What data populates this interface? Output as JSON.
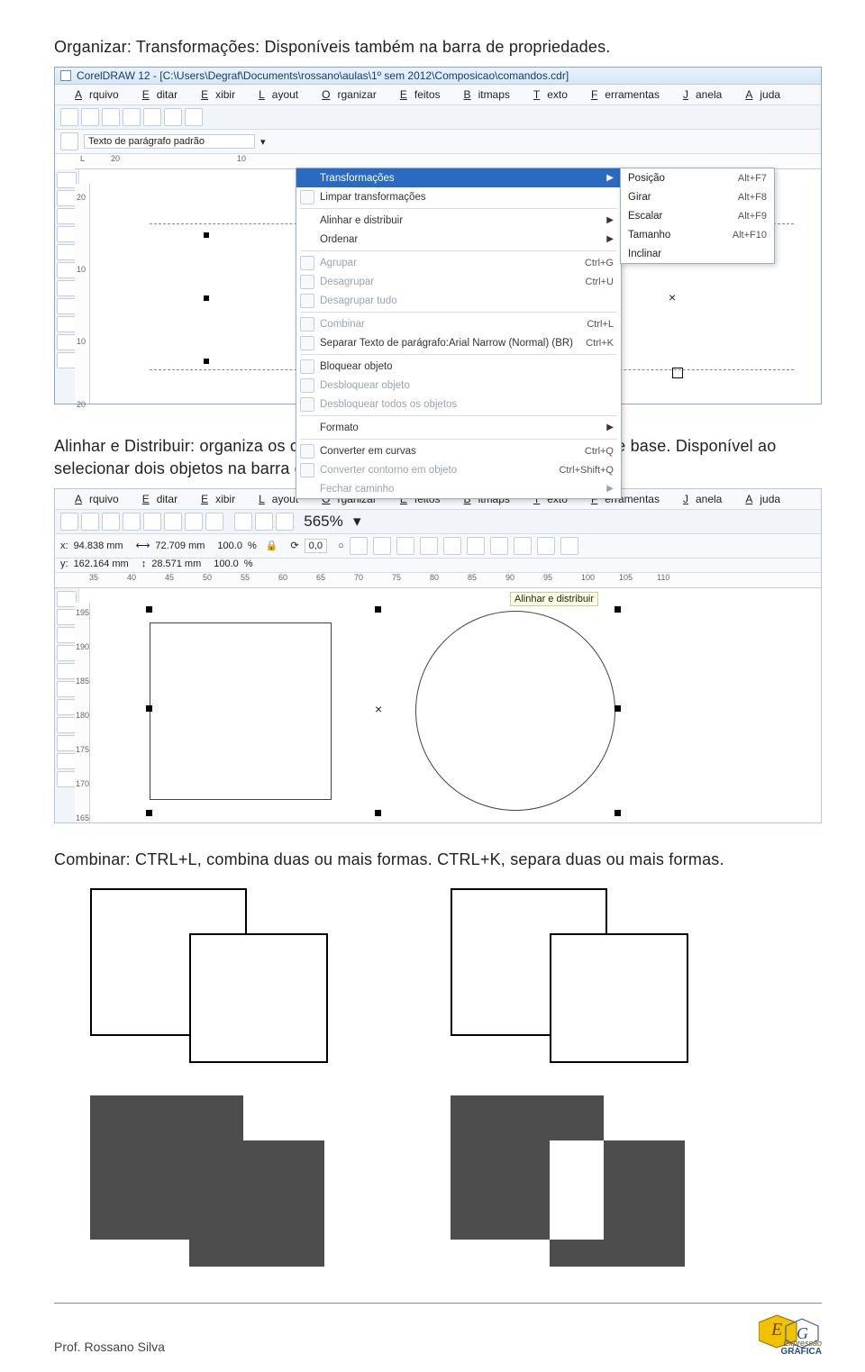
{
  "heading1": "Organizar: Transformações: Disponíveis também na barra de propriedades.",
  "screenshot1": {
    "title": "CorelDRAW 12 - [C:\\Users\\Degraf\\Documents\\rossano\\aulas\\1º sem 2012\\Composicao\\comandos.cdr]",
    "menubar": [
      "Arquivo",
      "Editar",
      "Exibir",
      "Layout",
      "Organizar",
      "Efeitos",
      "Bitmaps",
      "Texto",
      "Ferramentas",
      "Janela",
      "Ajuda"
    ],
    "prop_field": "Texto de parágrafo padrão ",
    "ruler_start": "L",
    "ruler_val": "20",
    "menu_items": [
      {
        "label": "Transformações",
        "sel": true,
        "arrow": true
      },
      {
        "label": "Limpar transformações",
        "icon": true
      },
      {
        "sep": true
      },
      {
        "label": "Alinhar e distribuir",
        "arrow": true
      },
      {
        "label": "Ordenar",
        "arrow": true
      },
      {
        "sep": true
      },
      {
        "label": "Agrupar",
        "dis": true,
        "icon": true,
        "sc": "Ctrl+G"
      },
      {
        "label": "Desagrupar",
        "dis": true,
        "icon": true,
        "sc": "Ctrl+U"
      },
      {
        "label": "Desagrupar tudo",
        "dis": true,
        "icon": true
      },
      {
        "sep": true
      },
      {
        "label": "Combinar",
        "dis": true,
        "icon": true,
        "sc": "Ctrl+L"
      },
      {
        "label": "Separar Texto de parágrafo:Arial Narrow (Normal) (BR)",
        "icon": true,
        "sc": "Ctrl+K"
      },
      {
        "sep": true
      },
      {
        "label": "Bloquear objeto",
        "icon": true
      },
      {
        "label": "Desbloquear objeto",
        "dis": true,
        "icon": true
      },
      {
        "label": "Desbloquear todos os objetos",
        "dis": true,
        "icon": true
      },
      {
        "sep": true
      },
      {
        "label": "Formato",
        "arrow": true
      },
      {
        "sep": true
      },
      {
        "label": "Converter em curvas",
        "icon": true,
        "sc": "Ctrl+Q"
      },
      {
        "label": "Converter contorno em objeto",
        "dis": true,
        "icon": true,
        "sc": "Ctrl+Shift+Q"
      },
      {
        "label": "Fechar caminho",
        "dis": true,
        "arrow": true
      }
    ],
    "submenu": [
      {
        "label": "Posição",
        "sc": "Alt+F7"
      },
      {
        "label": "Girar",
        "sc": "Alt+F8"
      },
      {
        "label": "Escalar",
        "sc": "Alt+F9"
      },
      {
        "label": "Tamanho",
        "sc": "Alt+F10"
      },
      {
        "label": "Inclinar"
      }
    ]
  },
  "heading2": "Alinhar e Distribuir: organiza os objetos os alinhando pelo centro, lado, topo e base. Disponível ao selecionar dois objetos na barra de ferramentas e no Menu: Organizar.",
  "screenshot2": {
    "menubar": [
      "Arquivo",
      "Editar",
      "Exibir",
      "Layout",
      "Organizar",
      "Efeitos",
      "Bitmaps",
      "Texto",
      "Ferramentas",
      "Janela",
      "Ajuda"
    ],
    "zoom": "565%",
    "coords": {
      "xlabel": "x:",
      "xval": "94.838 mm",
      "ylabel": "y:",
      "yval": "162.164 mm",
      "w": "72.709 mm",
      "h": "28.571 mm",
      "sx": "100.0",
      "sy": "100.0",
      "rot": "0,0"
    },
    "ruler_h": [
      "35",
      "40",
      "45",
      "50",
      "55",
      "60",
      "65",
      "70",
      "75",
      "80",
      "85",
      "90",
      "95",
      "100",
      "105",
      "110"
    ],
    "ruler_v": [
      "195",
      "190",
      "185",
      "180",
      "175",
      "170",
      "165"
    ],
    "tooltip": "Alinhar e distribuir"
  },
  "heading3": "Combinar: CTRL+L, combina duas ou mais formas. CTRL+K, separa duas ou mais formas.",
  "footer": {
    "author": "Prof. Rossano Silva",
    "logo_top": "Expressão",
    "logo_bottom": "GRÁFICA"
  }
}
